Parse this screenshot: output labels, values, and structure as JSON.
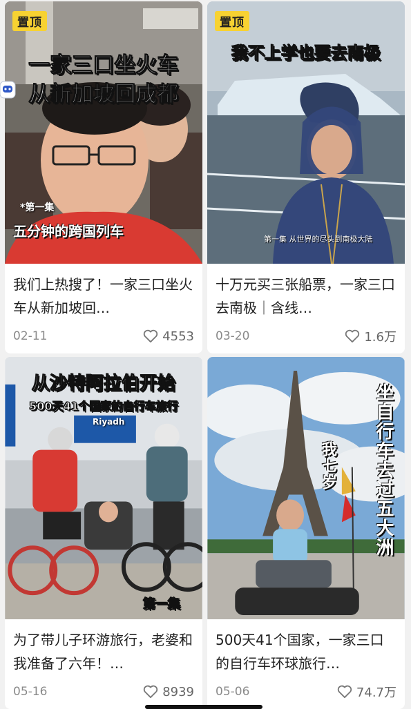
{
  "pin_label": "置顶",
  "cards": [
    {
      "overlay_title_line1": "一家三口坐火车",
      "overlay_title_line2": "从新加坡回成都",
      "episode_tag": "*第一集",
      "subtitle": "五分钟的跨国列车",
      "description": "我们上热搜了！一家三口坐火车从新加坡回…",
      "date": "02-11",
      "likes": "4553",
      "pinned": true
    },
    {
      "overlay_title": "我不上学也要去南极",
      "episode_caption": "第一集 从世界的尽头到南极大陆",
      "description": "十万元买三张船票，一家三口去南极｜含线…",
      "date": "03-20",
      "likes": "1.6万",
      "pinned": true
    },
    {
      "overlay_title": "从沙特阿拉伯开始",
      "overlay_subtitle": "500天41个国家的自行车旅行",
      "sign_text": "Riyadh",
      "episode_tag": "第一集",
      "description": "为了带儿子环游旅行，老婆和我准备了六年！…",
      "date": "05-16",
      "likes": "8939"
    },
    {
      "vertical_title": "坐自行车去过五大洲",
      "vertical_side": "我七岁",
      "description": "500天41个国家，一家三口的自行车环球旅行…",
      "date": "05-06",
      "likes": "74.7万"
    }
  ]
}
